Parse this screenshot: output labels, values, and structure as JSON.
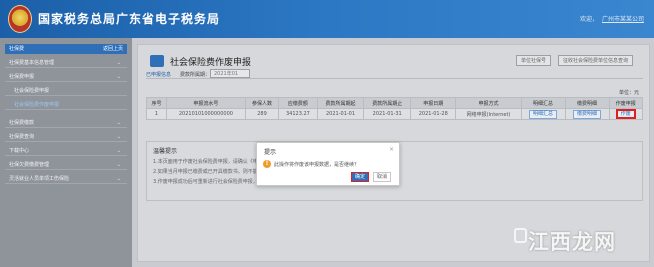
{
  "header": {
    "app_title": "国家税务总局广东省电子税务局",
    "welcome": "欢迎，",
    "user_name": "广州市某某公司"
  },
  "sidebar": {
    "head_label": "社保费",
    "back_label": "返回上页",
    "items": [
      {
        "label": "社保费基本信息管理",
        "chevron": "⌄"
      },
      {
        "label": "社保费申报",
        "chevron": "⌄"
      },
      {
        "label": "社会保险费申报",
        "chevron": ""
      },
      {
        "label": "社会保险费作废申报",
        "chevron": ""
      },
      {
        "label": "社保费缴款",
        "chevron": "⌄"
      },
      {
        "label": "社保费查询",
        "chevron": "⌄"
      },
      {
        "label": "下载中心",
        "chevron": "⌄"
      },
      {
        "label": "社保欠费缴费管理",
        "chevron": "⌄"
      },
      {
        "label": "灵活就业人员单项工伤保险",
        "chevron": "⌄"
      }
    ]
  },
  "main": {
    "page_title": "社会保险费作废申报",
    "btn_export": "单位社保号",
    "btn_company": "征收社会保险费单位信息查询",
    "tab_unreported": "已申报信息",
    "period_label": "费款所属期：",
    "period_value": "2021年01",
    "unit_label": "单位：元",
    "table": {
      "headers": [
        "序号",
        "申报流水号",
        "参保人数",
        "应缴费额",
        "费款所属期起",
        "费款所属期止",
        "申报日期",
        "申报方式",
        "明细汇总",
        "缴费明细",
        "作废申报"
      ],
      "rows": [
        {
          "no": "1",
          "serial": "20210101000000000",
          "persons": "289",
          "amount": "34123.27",
          "start": "2021-01-01",
          "end": "2021-01-31",
          "date": "2021-01-28",
          "method": "网络申报(Internet)",
          "summary": "明细汇总",
          "detail": "缴费明细",
          "action": "作废"
        }
      ]
    },
    "tips": {
      "title": "温馨提示",
      "lines": [
        "1.本页面用于作废社会保险费申报，请确认《申报数据》信息无误后，再进行操作。",
        "2.如果当月申报已缴费或已开具缴款书，则不能作废申报，需先作废缴款书后再操作。",
        "3.作废申报成功后可重新进行社会保险费申报，请及时在本页面核对申报数据。"
      ]
    }
  },
  "modal": {
    "title": "提示",
    "close": "×",
    "warn_glyph": "!",
    "message": "此操作将作废该申报数据，是否继续？",
    "ok": "确定",
    "cancel": "取消"
  },
  "watermark": {
    "text": "江西龙网"
  },
  "colors": {
    "header_blue": "#2c78c4",
    "accent_blue": "#2e6fb8",
    "highlight_red": "#e02020",
    "warn_orange": "#f29a26"
  }
}
